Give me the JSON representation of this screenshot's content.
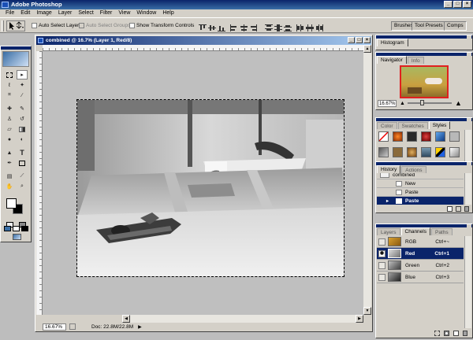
{
  "app": {
    "title": "Adobe Photoshop"
  },
  "menu": [
    "File",
    "Edit",
    "Image",
    "Layer",
    "Select",
    "Filter",
    "View",
    "Window",
    "Help"
  ],
  "options": {
    "auto_select_layer": "Auto Select Layer",
    "auto_select_groups": "Auto Select Groups",
    "show_transform_controls": "Show Transform Controls",
    "well_tabs": [
      "Brushes",
      "Tool Presets",
      "Comps"
    ]
  },
  "document": {
    "title": "combined @ 16.7% (Layer 1, Red/8)",
    "zoom": "16.67%",
    "info": "Doc: 22.8M/22.8M"
  },
  "palettes": {
    "histogram": {
      "tab": "Histogram"
    },
    "navigator": {
      "tabs": [
        "Navigator",
        "Info"
      ],
      "zoom": "16.67%"
    },
    "color": {
      "tabs": [
        "Color",
        "Swatches",
        "Styles"
      ]
    },
    "history": {
      "tabs": [
        "History",
        "Actions"
      ],
      "items": [
        "combined",
        "New",
        "Paste",
        "Paste"
      ]
    },
    "layers": {
      "tabs": [
        "Layers",
        "Channels",
        "Paths"
      ],
      "channels": [
        {
          "name": "RGB",
          "shortcut": "Ctrl+~"
        },
        {
          "name": "Red",
          "shortcut": "Ctrl+1"
        },
        {
          "name": "Green",
          "shortcut": "Ctrl+2"
        },
        {
          "name": "Blue",
          "shortcut": "Ctrl+3"
        }
      ]
    }
  },
  "colors": {
    "title_bar": "#0a246a",
    "chrome": "#d4d0c8",
    "canvas_bg": "#bfbfbf",
    "selection": "#0a246a"
  }
}
